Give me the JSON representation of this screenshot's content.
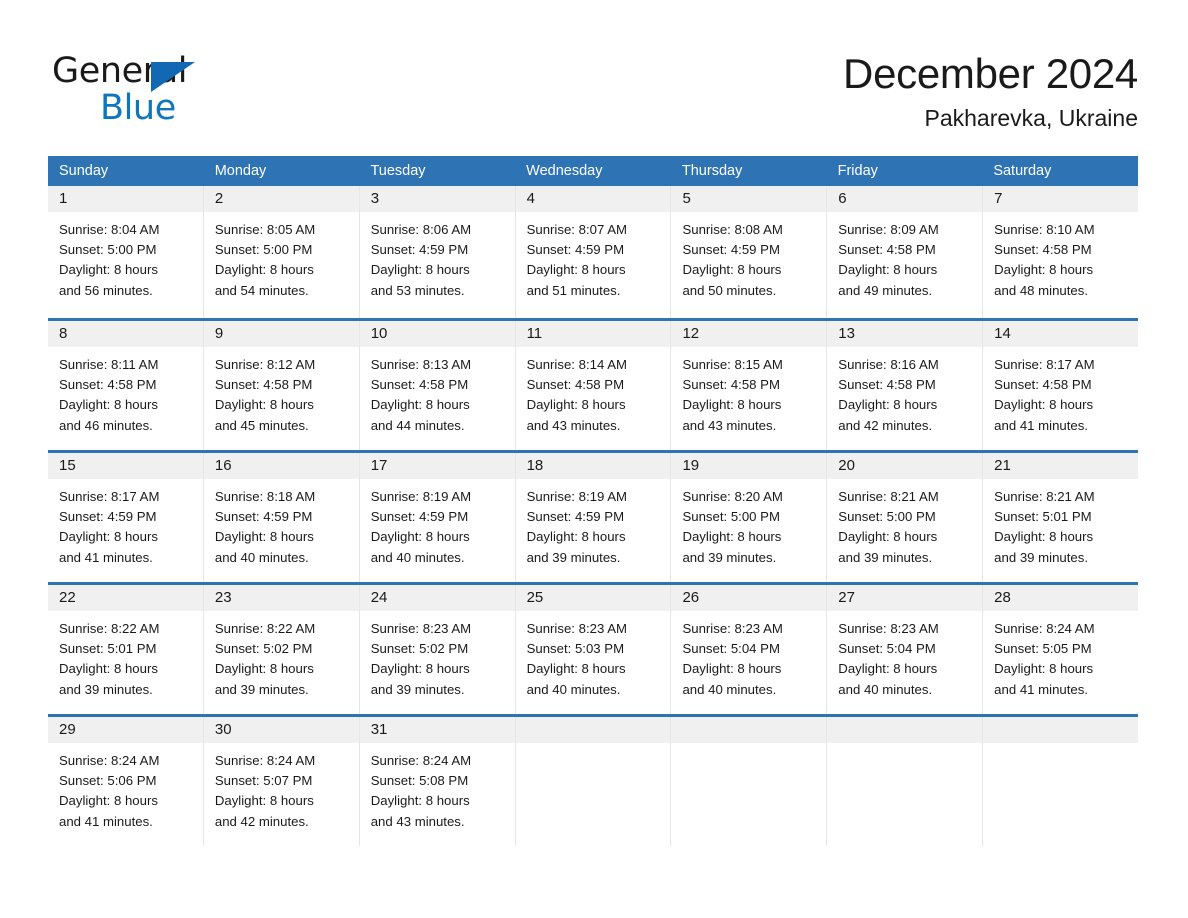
{
  "brand": {
    "name_part1": "General",
    "name_part2": "Blue",
    "accent_color": "#0e76bc",
    "triangle_color": "#1268b3"
  },
  "header": {
    "month_title": "December 2024",
    "location": "Pakharevka, Ukraine"
  },
  "calendar": {
    "header_color": "#2e74b5",
    "day_band_color": "#f0f0f0",
    "weekdays": [
      "Sunday",
      "Monday",
      "Tuesday",
      "Wednesday",
      "Thursday",
      "Friday",
      "Saturday"
    ],
    "weeks": [
      [
        {
          "day": "1",
          "sunrise": "Sunrise: 8:04 AM",
          "sunset": "Sunset: 5:00 PM",
          "daylight_line1": "Daylight: 8 hours",
          "daylight_line2": "and 56 minutes."
        },
        {
          "day": "2",
          "sunrise": "Sunrise: 8:05 AM",
          "sunset": "Sunset: 5:00 PM",
          "daylight_line1": "Daylight: 8 hours",
          "daylight_line2": "and 54 minutes."
        },
        {
          "day": "3",
          "sunrise": "Sunrise: 8:06 AM",
          "sunset": "Sunset: 4:59 PM",
          "daylight_line1": "Daylight: 8 hours",
          "daylight_line2": "and 53 minutes."
        },
        {
          "day": "4",
          "sunrise": "Sunrise: 8:07 AM",
          "sunset": "Sunset: 4:59 PM",
          "daylight_line1": "Daylight: 8 hours",
          "daylight_line2": "and 51 minutes."
        },
        {
          "day": "5",
          "sunrise": "Sunrise: 8:08 AM",
          "sunset": "Sunset: 4:59 PM",
          "daylight_line1": "Daylight: 8 hours",
          "daylight_line2": "and 50 minutes."
        },
        {
          "day": "6",
          "sunrise": "Sunrise: 8:09 AM",
          "sunset": "Sunset: 4:58 PM",
          "daylight_line1": "Daylight: 8 hours",
          "daylight_line2": "and 49 minutes."
        },
        {
          "day": "7",
          "sunrise": "Sunrise: 8:10 AM",
          "sunset": "Sunset: 4:58 PM",
          "daylight_line1": "Daylight: 8 hours",
          "daylight_line2": "and 48 minutes."
        }
      ],
      [
        {
          "day": "8",
          "sunrise": "Sunrise: 8:11 AM",
          "sunset": "Sunset: 4:58 PM",
          "daylight_line1": "Daylight: 8 hours",
          "daylight_line2": "and 46 minutes."
        },
        {
          "day": "9",
          "sunrise": "Sunrise: 8:12 AM",
          "sunset": "Sunset: 4:58 PM",
          "daylight_line1": "Daylight: 8 hours",
          "daylight_line2": "and 45 minutes."
        },
        {
          "day": "10",
          "sunrise": "Sunrise: 8:13 AM",
          "sunset": "Sunset: 4:58 PM",
          "daylight_line1": "Daylight: 8 hours",
          "daylight_line2": "and 44 minutes."
        },
        {
          "day": "11",
          "sunrise": "Sunrise: 8:14 AM",
          "sunset": "Sunset: 4:58 PM",
          "daylight_line1": "Daylight: 8 hours",
          "daylight_line2": "and 43 minutes."
        },
        {
          "day": "12",
          "sunrise": "Sunrise: 8:15 AM",
          "sunset": "Sunset: 4:58 PM",
          "daylight_line1": "Daylight: 8 hours",
          "daylight_line2": "and 43 minutes."
        },
        {
          "day": "13",
          "sunrise": "Sunrise: 8:16 AM",
          "sunset": "Sunset: 4:58 PM",
          "daylight_line1": "Daylight: 8 hours",
          "daylight_line2": "and 42 minutes."
        },
        {
          "day": "14",
          "sunrise": "Sunrise: 8:17 AM",
          "sunset": "Sunset: 4:58 PM",
          "daylight_line1": "Daylight: 8 hours",
          "daylight_line2": "and 41 minutes."
        }
      ],
      [
        {
          "day": "15",
          "sunrise": "Sunrise: 8:17 AM",
          "sunset": "Sunset: 4:59 PM",
          "daylight_line1": "Daylight: 8 hours",
          "daylight_line2": "and 41 minutes."
        },
        {
          "day": "16",
          "sunrise": "Sunrise: 8:18 AM",
          "sunset": "Sunset: 4:59 PM",
          "daylight_line1": "Daylight: 8 hours",
          "daylight_line2": "and 40 minutes."
        },
        {
          "day": "17",
          "sunrise": "Sunrise: 8:19 AM",
          "sunset": "Sunset: 4:59 PM",
          "daylight_line1": "Daylight: 8 hours",
          "daylight_line2": "and 40 minutes."
        },
        {
          "day": "18",
          "sunrise": "Sunrise: 8:19 AM",
          "sunset": "Sunset: 4:59 PM",
          "daylight_line1": "Daylight: 8 hours",
          "daylight_line2": "and 39 minutes."
        },
        {
          "day": "19",
          "sunrise": "Sunrise: 8:20 AM",
          "sunset": "Sunset: 5:00 PM",
          "daylight_line1": "Daylight: 8 hours",
          "daylight_line2": "and 39 minutes."
        },
        {
          "day": "20",
          "sunrise": "Sunrise: 8:21 AM",
          "sunset": "Sunset: 5:00 PM",
          "daylight_line1": "Daylight: 8 hours",
          "daylight_line2": "and 39 minutes."
        },
        {
          "day": "21",
          "sunrise": "Sunrise: 8:21 AM",
          "sunset": "Sunset: 5:01 PM",
          "daylight_line1": "Daylight: 8 hours",
          "daylight_line2": "and 39 minutes."
        }
      ],
      [
        {
          "day": "22",
          "sunrise": "Sunrise: 8:22 AM",
          "sunset": "Sunset: 5:01 PM",
          "daylight_line1": "Daylight: 8 hours",
          "daylight_line2": "and 39 minutes."
        },
        {
          "day": "23",
          "sunrise": "Sunrise: 8:22 AM",
          "sunset": "Sunset: 5:02 PM",
          "daylight_line1": "Daylight: 8 hours",
          "daylight_line2": "and 39 minutes."
        },
        {
          "day": "24",
          "sunrise": "Sunrise: 8:23 AM",
          "sunset": "Sunset: 5:02 PM",
          "daylight_line1": "Daylight: 8 hours",
          "daylight_line2": "and 39 minutes."
        },
        {
          "day": "25",
          "sunrise": "Sunrise: 8:23 AM",
          "sunset": "Sunset: 5:03 PM",
          "daylight_line1": "Daylight: 8 hours",
          "daylight_line2": "and 40 minutes."
        },
        {
          "day": "26",
          "sunrise": "Sunrise: 8:23 AM",
          "sunset": "Sunset: 5:04 PM",
          "daylight_line1": "Daylight: 8 hours",
          "daylight_line2": "and 40 minutes."
        },
        {
          "day": "27",
          "sunrise": "Sunrise: 8:23 AM",
          "sunset": "Sunset: 5:04 PM",
          "daylight_line1": "Daylight: 8 hours",
          "daylight_line2": "and 40 minutes."
        },
        {
          "day": "28",
          "sunrise": "Sunrise: 8:24 AM",
          "sunset": "Sunset: 5:05 PM",
          "daylight_line1": "Daylight: 8 hours",
          "daylight_line2": "and 41 minutes."
        }
      ],
      [
        {
          "day": "29",
          "sunrise": "Sunrise: 8:24 AM",
          "sunset": "Sunset: 5:06 PM",
          "daylight_line1": "Daylight: 8 hours",
          "daylight_line2": "and 41 minutes."
        },
        {
          "day": "30",
          "sunrise": "Sunrise: 8:24 AM",
          "sunset": "Sunset: 5:07 PM",
          "daylight_line1": "Daylight: 8 hours",
          "daylight_line2": "and 42 minutes."
        },
        {
          "day": "31",
          "sunrise": "Sunrise: 8:24 AM",
          "sunset": "Sunset: 5:08 PM",
          "daylight_line1": "Daylight: 8 hours",
          "daylight_line2": "and 43 minutes."
        },
        {
          "day": "",
          "sunrise": "",
          "sunset": "",
          "daylight_line1": "",
          "daylight_line2": ""
        },
        {
          "day": "",
          "sunrise": "",
          "sunset": "",
          "daylight_line1": "",
          "daylight_line2": ""
        },
        {
          "day": "",
          "sunrise": "",
          "sunset": "",
          "daylight_line1": "",
          "daylight_line2": ""
        },
        {
          "day": "",
          "sunrise": "",
          "sunset": "",
          "daylight_line1": "",
          "daylight_line2": ""
        }
      ]
    ]
  }
}
